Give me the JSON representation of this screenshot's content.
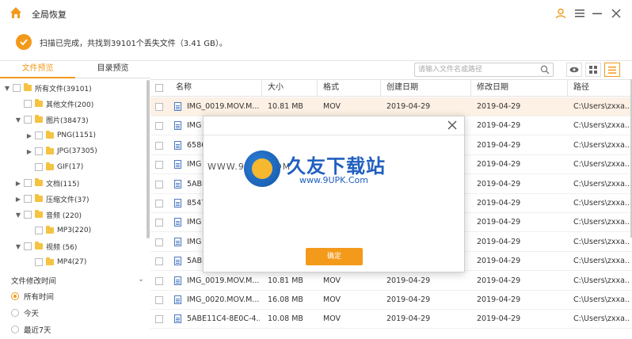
{
  "window": {
    "title": "全局恢复"
  },
  "status": {
    "text": "扫描已完成，共找到39101个丢失文件（3.41 GB）。"
  },
  "left_tabs": [
    "文件预览",
    "目录预览"
  ],
  "tree": [
    {
      "label": "所有文件(39101)"
    },
    {
      "label": "其他文件(200)"
    },
    {
      "label": "图片(38473)"
    },
    {
      "label": "PNG(1151)"
    },
    {
      "label": "JPG(37305)"
    },
    {
      "label": "GIF(17)"
    },
    {
      "label": "文档(115)"
    },
    {
      "label": "压缩文件(37)"
    },
    {
      "label": "音频 (220)"
    },
    {
      "label": "MP3(220)"
    },
    {
      "label": "视频 (56)"
    },
    {
      "label": "MP4(27)"
    }
  ],
  "filter": {
    "title": "文件修改时间",
    "options": [
      "所有时间",
      "今天",
      "最近7天"
    ],
    "selected": "所有时间"
  },
  "search": {
    "placeholder": "请输入文件名或路径"
  },
  "table": {
    "columns": [
      "名称",
      "大小",
      "格式",
      "创建日期",
      "修改日期",
      "路径"
    ],
    "rows": [
      {
        "name": "IMG_0019.MOV.M...",
        "size": "10.81 MB",
        "format": "MOV",
        "created": "2019-04-29",
        "modified": "2019-04-29",
        "path": "C:\\Users\\zxxa..."
      },
      {
        "name": "IMG",
        "size": "",
        "format": "",
        "created": "",
        "modified": "2019-04-29",
        "path": "C:\\Users\\zxxa..."
      },
      {
        "name": "6586",
        "size": "",
        "format": "",
        "created": "",
        "modified": "2019-04-29",
        "path": "C:\\Users\\zxxa..."
      },
      {
        "name": "IMG",
        "size": "",
        "format": "",
        "created": "",
        "modified": "2019-04-29",
        "path": "C:\\Users\\zxxa..."
      },
      {
        "name": "5ABE",
        "size": "",
        "format": "",
        "created": "",
        "modified": "2019-04-29",
        "path": "C:\\Users\\zxxa..."
      },
      {
        "name": "8547",
        "size": "",
        "format": "",
        "created": "",
        "modified": "2019-04-29",
        "path": "C:\\Users\\zxxa..."
      },
      {
        "name": "IMG",
        "size": "",
        "format": "",
        "created": "",
        "modified": "2019-04-29",
        "path": "C:\\Users\\zxxa..."
      },
      {
        "name": "IMG",
        "size": "",
        "format": "",
        "created": "",
        "modified": "2019-04-29",
        "path": "C:\\Users\\zxxa..."
      },
      {
        "name": "5ABE",
        "size": "",
        "format": "",
        "created": "",
        "modified": "2019-04-29",
        "path": "C:\\Users\\zxxa..."
      },
      {
        "name": "IMG_0019.MOV.M...",
        "size": "10.81 MB",
        "format": "MOV",
        "created": "2019-04-29",
        "modified": "2019-04-29",
        "path": "C:\\Users\\zxxa..."
      },
      {
        "name": "IMG_0020.MOV.M...",
        "size": "16.08 MB",
        "format": "MOV",
        "created": "2019-04-29",
        "modified": "2019-04-29",
        "path": "C:\\Users\\zxxa..."
      },
      {
        "name": "5ABE11C4-8E0C-4...",
        "size": "10.08 MB",
        "format": "MOV",
        "created": "2019-04-29",
        "modified": "2019-04-29",
        "path": "C:\\Users\\zxxa..."
      }
    ]
  },
  "dialog": {
    "ok_label": "确定"
  },
  "watermark": {
    "title": "久友下载站",
    "url": "www.9UPK.Com",
    "url_left": "WWW.9UPK.COM"
  },
  "colors": {
    "accent": "#f39a1b",
    "watermark": "#1f5fbf"
  }
}
